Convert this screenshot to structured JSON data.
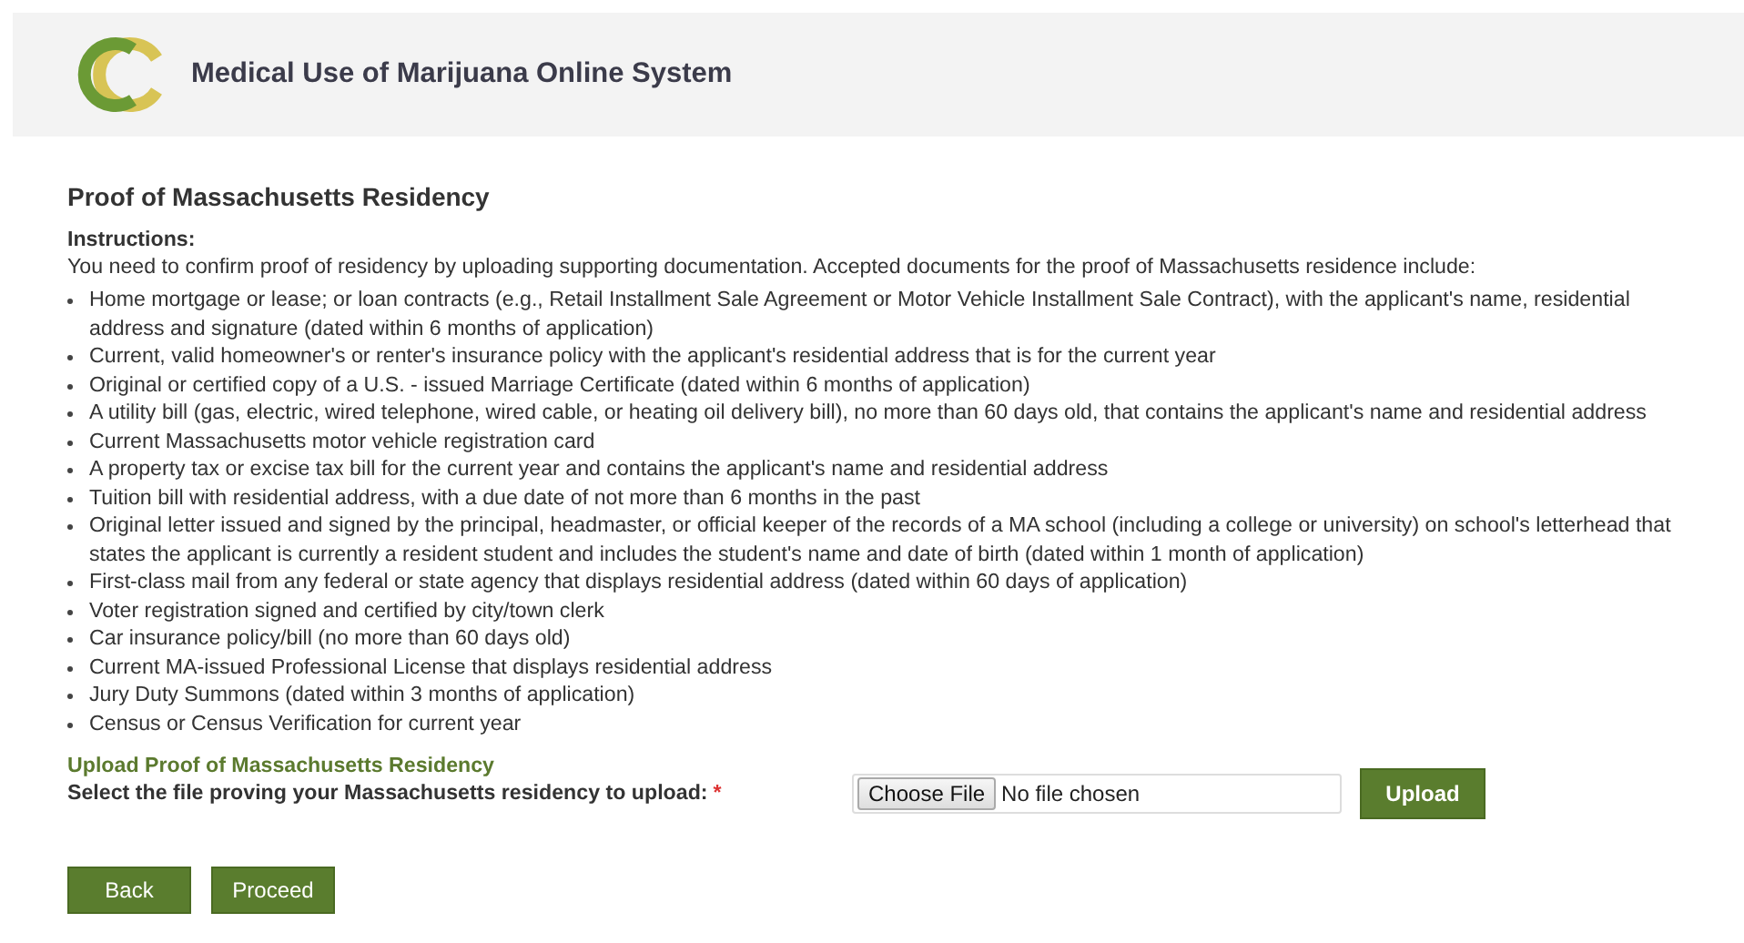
{
  "header": {
    "title": "Medical Use of Marijuana Online System"
  },
  "page_title": "Proof of Massachusetts Residency",
  "instructions": {
    "label": "Instructions:",
    "intro": "You need to confirm proof of residency by uploading supporting documentation. Accepted documents for the proof of Massachusetts residence include:",
    "items": [
      "Home mortgage or lease; or loan contracts (e.g., Retail Installment Sale Agreement or Motor Vehicle Installment Sale Contract), with the applicant's name, residential address and signature (dated within 6 months of application)",
      "Current, valid homeowner's or renter's insurance policy with the applicant's residential address that is for the current year",
      "Original or certified copy of a U.S. - issued Marriage Certificate (dated within 6 months of application)",
      "A utility bill (gas, electric, wired telephone, wired cable, or heating oil delivery bill), no more than 60 days old, that contains the applicant's name and residential address",
      "Current Massachusetts motor vehicle registration card",
      "A property tax or excise tax bill for the current year and contains the applicant's name and residential address",
      "Tuition bill with residential address, with a due date of not more than 6 months in the past",
      "Original letter issued and signed by the principal, headmaster, or official keeper of the records of a MA school (including a college or university) on school's letterhead that states the applicant is currently a resident student and includes the student's name and date of birth (dated within 1 month of application)",
      "First-class mail from any federal or state agency that displays residential address (dated within 60 days of application)",
      "Voter registration signed and certified by city/town clerk",
      "Car insurance policy/bill (no more than 60 days old)",
      "Current MA-issued Professional License that displays residential address",
      "Jury Duty Summons (dated within 3 months of application)",
      "Census or Census Verification for current year"
    ]
  },
  "upload": {
    "heading": "Upload Proof of Massachusetts Residency",
    "label": "Select the file proving your Massachusetts residency to upload:",
    "required_mark": "*",
    "choose_button": "Choose File",
    "file_status": "No file chosen",
    "upload_button": "Upload"
  },
  "buttons": [
    "Back",
    "Proceed"
  ]
}
